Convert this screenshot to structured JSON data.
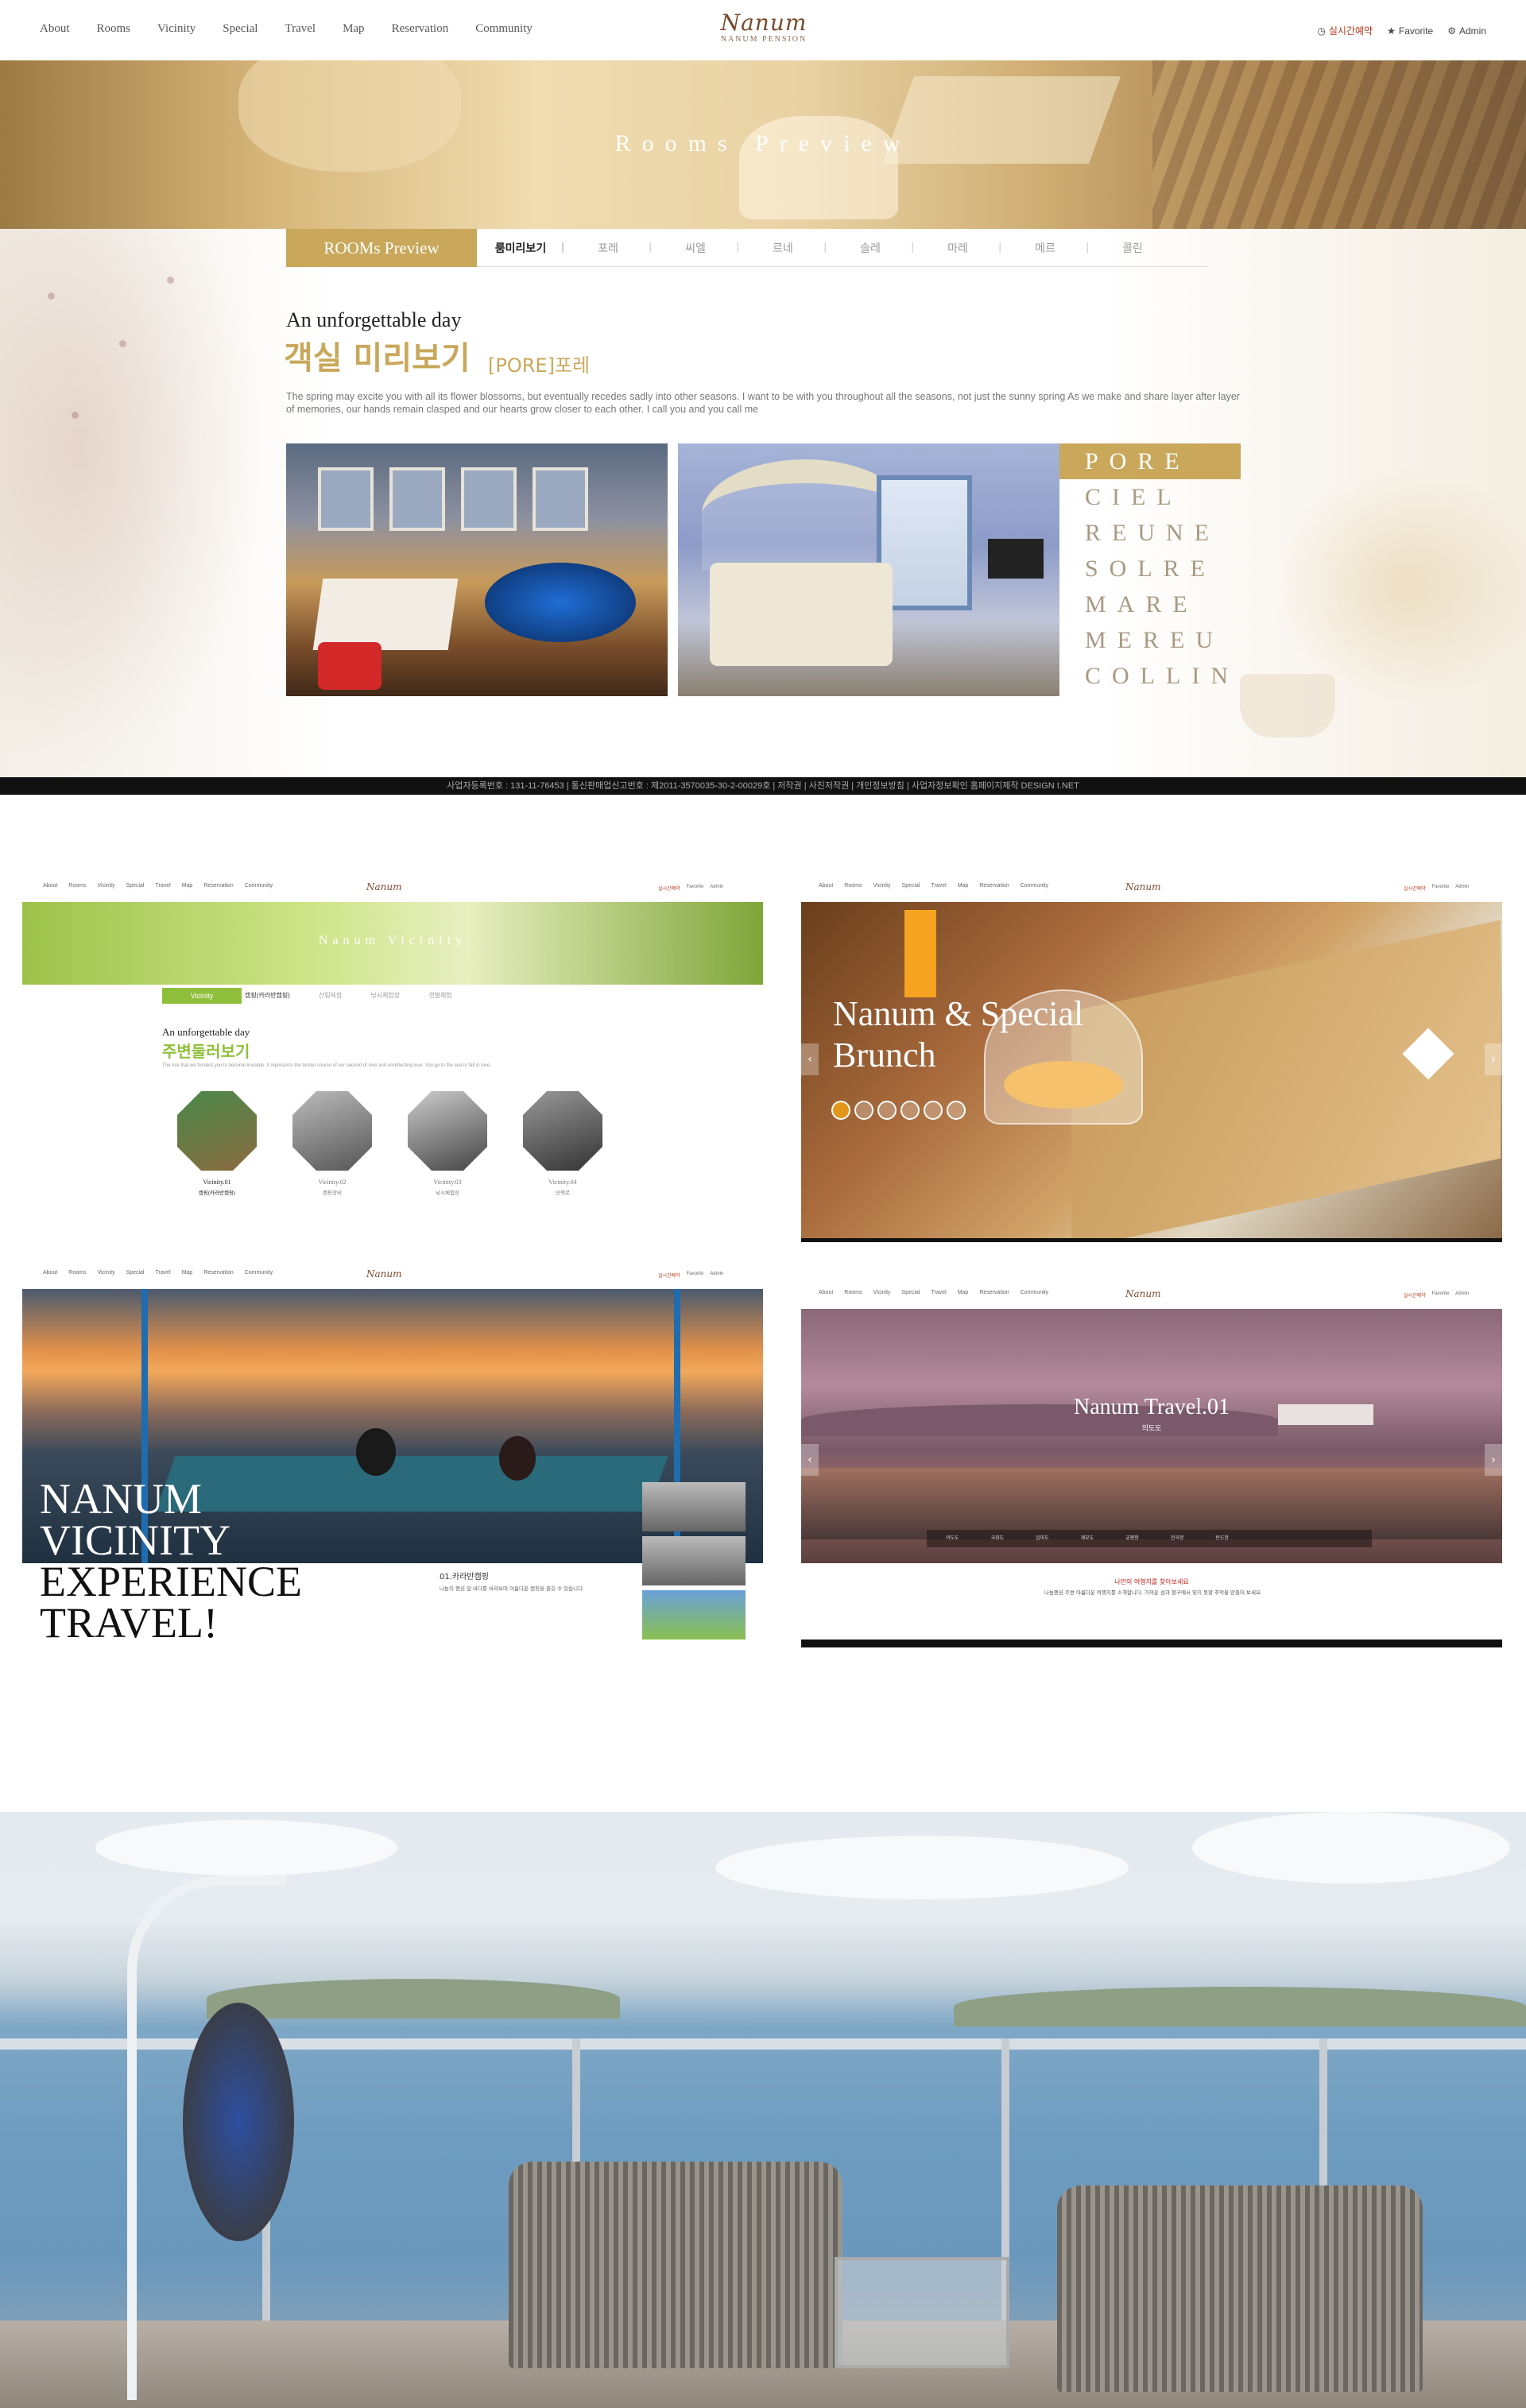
{
  "header": {
    "nav": [
      "About",
      "Rooms",
      "Vicinity",
      "Special",
      "Travel",
      "Map",
      "Reservation",
      "Community"
    ],
    "logo": "Nanum",
    "logo_sub": "NANUM PENSION",
    "reserve": "실시간예약",
    "favorite": "Favorite",
    "admin": "Admin"
  },
  "hero": {
    "title": "Rooms Preview"
  },
  "rooms": {
    "tab_active": "ROOMs Preview",
    "tabs": [
      "룸미리보기",
      "포레",
      "씨엘",
      "르네",
      "솔레",
      "마레",
      "메르",
      "콜린"
    ],
    "heading_en": "An unforgettable day",
    "heading_kr": "객실 미리보기",
    "heading_sub": "[PORE]포레",
    "description": "The spring may excite you with all its flower blossoms, but eventually recedes sadly into other seasons. I want to be with you throughout all the seasons, not just the sunny spring As we make and share layer after layer of memories, our hands remain clasped and our hearts grow closer to each other. I call you and you call me",
    "list": [
      "PORE",
      "CIEL",
      "REUNE",
      "SOLRE",
      "MARE",
      "MEREU",
      "COLLIN"
    ]
  },
  "footer": {
    "text": "사업자등록번호 : 131-11-76453  |  통신판매업신고번호 : 제2011-3570035-30-2-00029호  |  저작권  |  사진저작권  |  개인정보방침  |  사업자정보확인     홈페이지제작 DESIGN I.NET"
  },
  "vicinity": {
    "banner": "Nanum Vicinity",
    "tab": "Vicinity",
    "tabs": [
      "캠핑(카라반캠핑)",
      "산림욕장",
      "낚시체험장",
      "갯벌체험"
    ],
    "heading_en": "An unforgettable day",
    "heading_kr": "주변둘러보기",
    "desc": "The rise that we fondest you to become invisible. It represents the tender course of our second of love and unreflecting love. You go to the sea to fall in love.",
    "items": [
      {
        "label": "Vicinity.01",
        "sub": "캠핑(카라반캠핑)"
      },
      {
        "label": "Vicinity.02",
        "sub": "캠핑장비"
      },
      {
        "label": "Vicinity.03",
        "sub": "낚시체험장"
      },
      {
        "label": "Vicinity.04",
        "sub": "산책로"
      }
    ]
  },
  "special": {
    "title_line1": "Nanum & Special",
    "title_line2": "Brunch"
  },
  "experience": {
    "line1": "NANUM",
    "line2": "VICINITY",
    "line3": "EXPERIENCE",
    "line4": "TRAVEL!",
    "caption": "01.카라반캠핑",
    "caption_desc": "나눔의 펜션 앞 바다를 바라보며 아름다운 캠핑을 즐길 수 있습니다."
  },
  "travel": {
    "title": "Nanum Travel.01",
    "sub": "의도도",
    "nav": [
      "의도도",
      "국화도",
      "입파도",
      "제부도",
      "궁평항",
      "전곡항",
      "탄도항"
    ],
    "red_title": "나만의 여행지를 찾아보세요",
    "desc": "나눔펜션 주변 아름다운 여행지를 소개합니다. 가까운 섬과 항구에서 잊지 못할 추억을 만들어 보세요."
  },
  "colors": {
    "gold": "#c9a85b",
    "green": "#8fbf3a"
  }
}
